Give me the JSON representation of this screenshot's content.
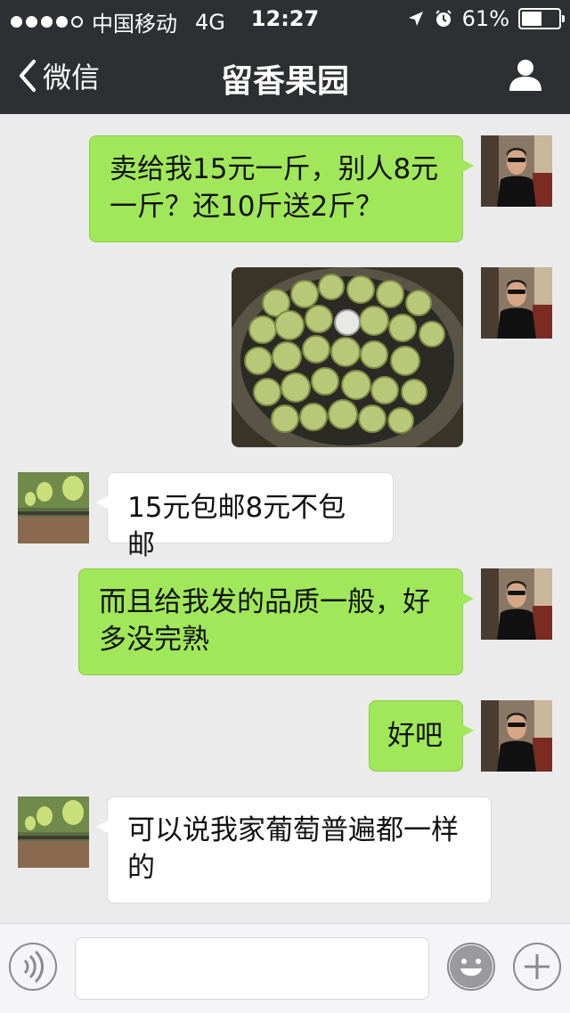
{
  "status_bar": {
    "carrier": "中国移动",
    "network": "4G",
    "time": "12:27",
    "battery": "61%",
    "battery_level": 0.61
  },
  "nav": {
    "back_label": "微信",
    "title": "留香果园"
  },
  "messages": [
    {
      "sender": "me",
      "type": "text",
      "lines": [
        "卖给我15元一斤，别人8元",
        "一斤？还10斤送2斤？"
      ]
    },
    {
      "sender": "me",
      "type": "image",
      "icon": "grapes-photo"
    },
    {
      "sender": "them",
      "type": "text",
      "lines": [
        "15元包邮8元不包邮"
      ]
    },
    {
      "sender": "me",
      "type": "text",
      "lines": [
        "而且给我发的品质一般，好",
        "多没完熟"
      ]
    },
    {
      "sender": "me",
      "type": "text",
      "lines": [
        "好吧"
      ]
    },
    {
      "sender": "them",
      "type": "text",
      "lines": [
        "可以说我家葡萄普遍都一样",
        "的"
      ]
    }
  ],
  "input_bar": {
    "voice_icon": "voice-icon",
    "emoji_icon": "emoji-icon",
    "plus_icon": "plus-icon"
  },
  "colors": {
    "nav_bg": "#2e2f33",
    "chat_bg": "#ebebeb",
    "outgoing_bubble": "#a0e75a",
    "incoming_bubble": "#ffffff"
  }
}
